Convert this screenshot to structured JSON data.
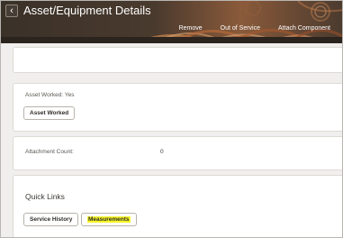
{
  "header": {
    "back_icon": "chevron-left-icon",
    "title": "Asset/Equipment Details",
    "actions": [
      "Remove",
      "Out of Service",
      "Attach Component"
    ],
    "background_color": "#3a3129"
  },
  "asset_worked": {
    "label": "Asset Worked: Yes",
    "button": "Asset Worked"
  },
  "attachments": {
    "label": "Attachment Count:",
    "value": "0"
  },
  "quick_links": {
    "title": "Quick Links",
    "service_history": "Service History",
    "measurements": "Measurements",
    "highlight_color": "#f6f62a"
  }
}
